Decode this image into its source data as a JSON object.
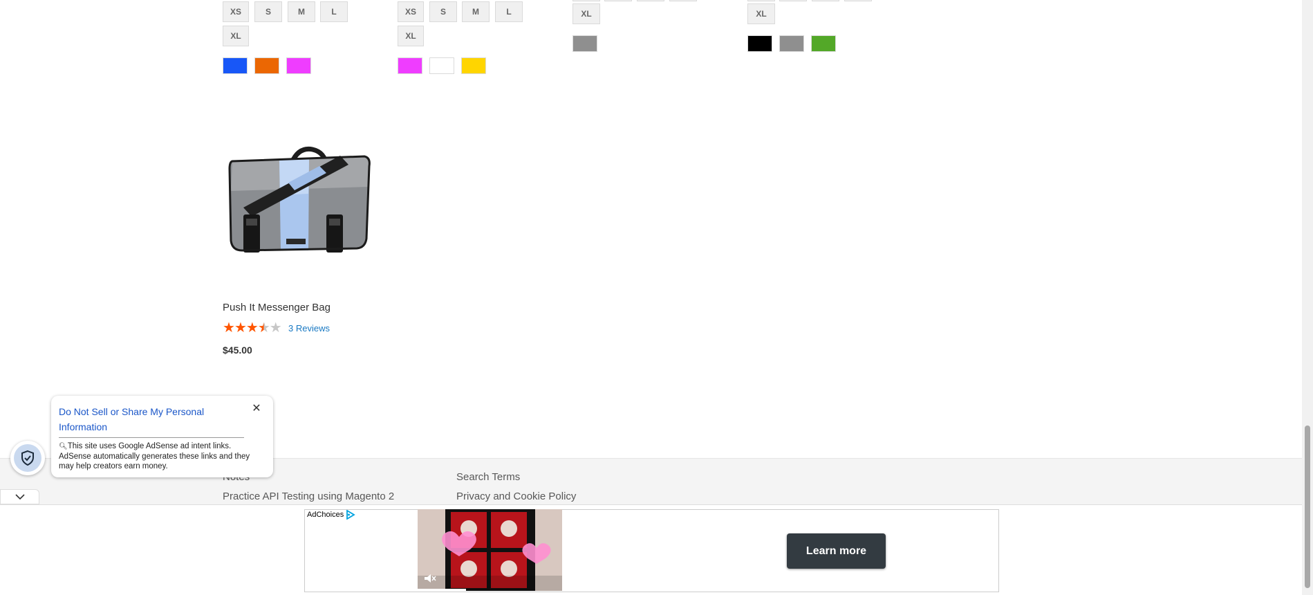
{
  "product_grid": {
    "card1": {
      "sizes": [
        "XS",
        "S",
        "M",
        "L",
        "XL"
      ],
      "colors": [
        "#1857f7",
        "#eb6703",
        "#ef3dff"
      ]
    },
    "card2": {
      "sizes": [
        "XS",
        "S",
        "M",
        "L",
        "XL"
      ],
      "colors": [
        "#ef3dff",
        "#ffffff",
        "#ffd500"
      ]
    },
    "card3": {
      "sizes": [
        "XL"
      ],
      "colors": [
        "#8f8f8f"
      ]
    },
    "card4": {
      "sizes": [
        "XL"
      ],
      "colors": [
        "#000000",
        "#8f8f8f",
        "#53a828"
      ]
    }
  },
  "product": {
    "name": "Push It Messenger Bag",
    "rating": 3.5,
    "rating_max": 5,
    "reviews": "3 Reviews",
    "price": "$45.00"
  },
  "footer": {
    "links": [
      "Notes",
      "Practice API Testing using Magento 2",
      "Search Terms",
      "Privacy and Cookie Policy"
    ]
  },
  "privacy_popup": {
    "title": "Do Not Sell or Share My Personal Information",
    "body": "This site uses Google AdSense ad intent links. AdSense automatically generates these links and they may help creators earn money.",
    "close_icon": "close-icon",
    "shield_icon": "shield-check-icon",
    "collapse_icon": "chevron-down-icon"
  },
  "ad": {
    "adchoices_label": "AdChoices",
    "cta": "Learn more"
  },
  "colors": {
    "link": "#1979c3",
    "star": "#ff5501",
    "footer_bg": "#f4f4f4",
    "cta_bg": "#333b41"
  }
}
